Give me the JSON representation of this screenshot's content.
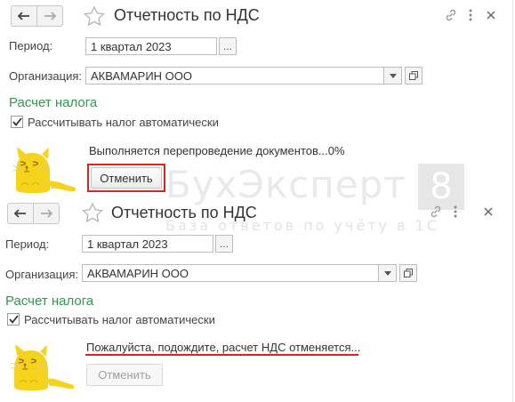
{
  "watermark": {
    "brand": "БухЭксперт",
    "tagline": "База ответов по учёту в 1С",
    "digit": "8"
  },
  "form_before": {
    "title": "Отчетность по НДС",
    "period_label": "Период:",
    "period_value": "1 квартал 2023",
    "period_select": "...",
    "org_label": "Организация:",
    "org_value": "АКВАМАРИН ООО",
    "section_title": "Расчет налога",
    "auto_calc_label": "Рассчитывать налог автоматически",
    "auto_calc_checked": true,
    "status_text": "Выполняется перепроведение документов...0%",
    "cancel_label": "Отменить",
    "cancel_enabled": true
  },
  "form_after": {
    "title": "Отчетность по НДС",
    "period_label": "Период:",
    "period_value": "1 квартал 2023",
    "period_select": "...",
    "org_label": "Организация:",
    "org_value": "АКВАМАРИН ООО",
    "section_title": "Расчет налога",
    "auto_calc_label": "Рассчитывать налог автоматически",
    "auto_calc_checked": true,
    "status_text": "Пожалуйста, подождите, расчет НДС отменяется...",
    "cancel_label": "Отменить",
    "cancel_enabled": false
  },
  "icons": {
    "back": "arrow-left-icon",
    "forward": "arrow-right-icon",
    "favorite": "star-icon",
    "link": "link-icon",
    "more": "more-vertical-icon",
    "close": "close-icon",
    "dropdown": "chevron-down-icon",
    "open": "open-form-icon",
    "checkbox": "checkmark-icon",
    "waiting": "cat-icon"
  },
  "colors": {
    "section_title": "#2e9a4a",
    "highlight": "#d9261c",
    "cat": "#f5d21c"
  }
}
